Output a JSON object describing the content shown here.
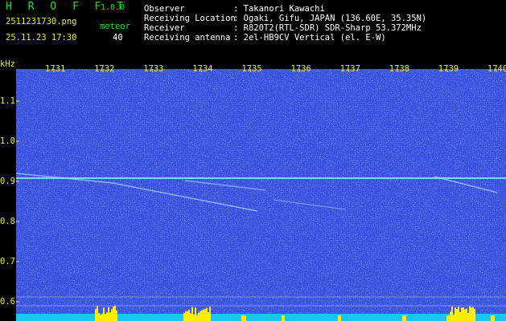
{
  "header": {
    "app_name": "H R O F F T",
    "version": "1.0.0",
    "filename": "2511231730.png",
    "meteor_label": "meteor",
    "datetime": "25.11.23 17:30",
    "meteor_count": "40",
    "info": [
      {
        "key": "Observer",
        "value": ": Takanori Kawachi"
      },
      {
        "key": "Receiving Location",
        "value": ": Ogaki, Gifu, JAPAN (136.60E, 35.35N)"
      },
      {
        "key": "Receiver",
        "value": ": R820T2(RTL-SDR) SDR-Sharp 53.372MHz"
      },
      {
        "key": "Receiving antenna",
        "value": ": 2el-HB9CV Vertical (el. E-W)"
      }
    ]
  },
  "colors": {
    "background": "#000000",
    "noise_base": "#0a1a8a",
    "carrier": "#8ae0ff",
    "meteor_trail": "#a8d8ff",
    "signal_bar": "#ffee00",
    "baseline_bar": "#18c8f0",
    "label_yellow": "#f0f000",
    "label_green": "#19e619"
  },
  "chart_data": {
    "type": "heatmap",
    "ylabel": "kHz",
    "x_ticks": [
      "1731",
      "1732",
      "1733",
      "1734",
      "1735",
      "1736",
      "1737",
      "1738",
      "1739",
      "1740"
    ],
    "y_ticks": [
      "1.1",
      "1.0",
      "0.9",
      "0.8",
      "0.7",
      "0.6"
    ],
    "y_range_khz": [
      0.57,
      1.18
    ],
    "carrier_khz": 0.908,
    "grid": false
  }
}
